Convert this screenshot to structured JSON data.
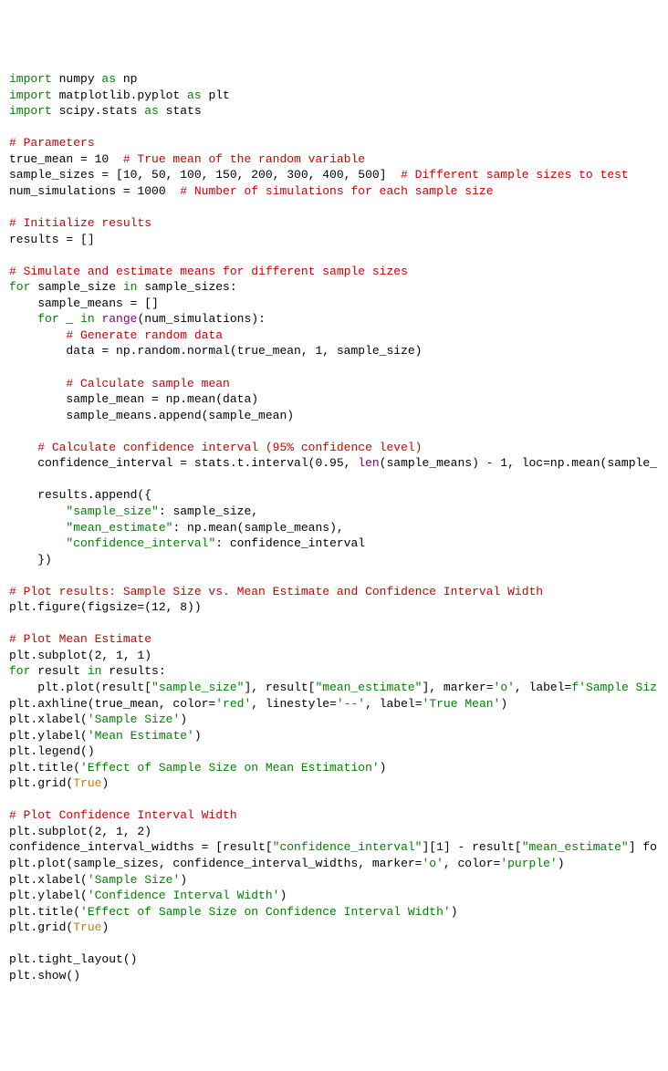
{
  "code": {
    "lines": [
      {
        "segments": [
          {
            "t": "import",
            "c": "kw"
          },
          {
            "t": " numpy "
          },
          {
            "t": "as",
            "c": "kw"
          },
          {
            "t": " np"
          }
        ]
      },
      {
        "segments": [
          {
            "t": "import",
            "c": "kw"
          },
          {
            "t": " matplotlib.pyplot "
          },
          {
            "t": "as",
            "c": "kw"
          },
          {
            "t": " plt"
          }
        ]
      },
      {
        "segments": [
          {
            "t": "import",
            "c": "kw"
          },
          {
            "t": " scipy.stats "
          },
          {
            "t": "as",
            "c": "kw"
          },
          {
            "t": " stats"
          }
        ]
      },
      {
        "segments": [
          {
            "t": ""
          }
        ]
      },
      {
        "segments": [
          {
            "t": "# Parameters",
            "c": "cm"
          }
        ]
      },
      {
        "segments": [
          {
            "t": "true_mean = 10  "
          },
          {
            "t": "# True mean of the random variable",
            "c": "cm"
          }
        ]
      },
      {
        "segments": [
          {
            "t": "sample_sizes = [10, 50, 100, 150, 200, 300, 400, 500]  "
          },
          {
            "t": "# Different sample sizes to test",
            "c": "cm"
          }
        ]
      },
      {
        "segments": [
          {
            "t": "num_simulations = 1000  "
          },
          {
            "t": "# Number of simulations for each sample size",
            "c": "cm"
          }
        ]
      },
      {
        "segments": [
          {
            "t": ""
          }
        ]
      },
      {
        "segments": [
          {
            "t": "# Initialize results",
            "c": "cm"
          }
        ]
      },
      {
        "segments": [
          {
            "t": "results = []"
          }
        ]
      },
      {
        "segments": [
          {
            "t": ""
          }
        ]
      },
      {
        "segments": [
          {
            "t": "# Simulate and estimate means for different sample sizes",
            "c": "cm"
          }
        ]
      },
      {
        "segments": [
          {
            "t": "for",
            "c": "kw"
          },
          {
            "t": " sample_size "
          },
          {
            "t": "in",
            "c": "kw"
          },
          {
            "t": " sample_sizes:"
          }
        ]
      },
      {
        "segments": [
          {
            "t": "    sample_means = []"
          }
        ]
      },
      {
        "segments": [
          {
            "t": "    "
          },
          {
            "t": "for",
            "c": "kw"
          },
          {
            "t": " _ "
          },
          {
            "t": "in",
            "c": "kw"
          },
          {
            "t": " "
          },
          {
            "t": "range",
            "c": "bi"
          },
          {
            "t": "(num_simulations):"
          }
        ]
      },
      {
        "segments": [
          {
            "t": "        "
          },
          {
            "t": "# Generate random data",
            "c": "cm"
          }
        ]
      },
      {
        "segments": [
          {
            "t": "        data = np.random.normal(true_mean, 1, sample_size)"
          }
        ]
      },
      {
        "segments": [
          {
            "t": ""
          }
        ]
      },
      {
        "segments": [
          {
            "t": "        "
          },
          {
            "t": "# Calculate sample mean",
            "c": "cm"
          }
        ]
      },
      {
        "segments": [
          {
            "t": "        sample_mean = np.mean(data)"
          }
        ]
      },
      {
        "segments": [
          {
            "t": "        sample_means.append(sample_mean)"
          }
        ]
      },
      {
        "segments": [
          {
            "t": ""
          }
        ]
      },
      {
        "segments": [
          {
            "t": "    "
          },
          {
            "t": "# Calculate confidence interval (95% confidence level)",
            "c": "cm"
          }
        ]
      },
      {
        "segments": [
          {
            "t": "    confidence_interval = stats.t.interval(0.95, "
          },
          {
            "t": "len",
            "c": "bi"
          },
          {
            "t": "(sample_means) - 1, loc=np.mean(sample_"
          }
        ]
      },
      {
        "segments": [
          {
            "t": ""
          }
        ]
      },
      {
        "segments": [
          {
            "t": "    results.append({"
          }
        ]
      },
      {
        "segments": [
          {
            "t": "        "
          },
          {
            "t": "\"sample_size\"",
            "c": "str"
          },
          {
            "t": ": sample_size,"
          }
        ]
      },
      {
        "segments": [
          {
            "t": "        "
          },
          {
            "t": "\"mean_estimate\"",
            "c": "str"
          },
          {
            "t": ": np.mean(sample_means),"
          }
        ]
      },
      {
        "segments": [
          {
            "t": "        "
          },
          {
            "t": "\"confidence_interval\"",
            "c": "str"
          },
          {
            "t": ": confidence_interval"
          }
        ]
      },
      {
        "segments": [
          {
            "t": "    })"
          }
        ]
      },
      {
        "segments": [
          {
            "t": ""
          }
        ]
      },
      {
        "segments": [
          {
            "t": "# Plot results: Sample Size vs. Mean Estimate and Confidence Interval Width",
            "c": "cm"
          }
        ]
      },
      {
        "segments": [
          {
            "t": "plt.figure(figsize=(12, 8))"
          }
        ]
      },
      {
        "segments": [
          {
            "t": ""
          }
        ]
      },
      {
        "segments": [
          {
            "t": "# Plot Mean Estimate",
            "c": "cm"
          }
        ]
      },
      {
        "segments": [
          {
            "t": "plt.subplot(2, 1, 1)"
          }
        ]
      },
      {
        "segments": [
          {
            "t": "for",
            "c": "kw"
          },
          {
            "t": " result "
          },
          {
            "t": "in",
            "c": "kw"
          },
          {
            "t": " results:"
          }
        ]
      },
      {
        "segments": [
          {
            "t": "    plt.plot(result["
          },
          {
            "t": "\"sample_size\"",
            "c": "str"
          },
          {
            "t": "], result["
          },
          {
            "t": "\"mean_estimate\"",
            "c": "str"
          },
          {
            "t": "], marker="
          },
          {
            "t": "'o'",
            "c": "str"
          },
          {
            "t": ", label="
          },
          {
            "t": "f'Sample Siz",
            "c": "str"
          }
        ]
      },
      {
        "segments": [
          {
            "t": "plt.axhline(true_mean, color="
          },
          {
            "t": "'red'",
            "c": "str"
          },
          {
            "t": ", linestyle="
          },
          {
            "t": "'--'",
            "c": "str"
          },
          {
            "t": ", label="
          },
          {
            "t": "'True Mean'",
            "c": "str"
          },
          {
            "t": ")"
          }
        ]
      },
      {
        "segments": [
          {
            "t": "plt.xlabel("
          },
          {
            "t": "'Sample Size'",
            "c": "str"
          },
          {
            "t": ")"
          }
        ]
      },
      {
        "segments": [
          {
            "t": "plt.ylabel("
          },
          {
            "t": "'Mean Estimate'",
            "c": "str"
          },
          {
            "t": ")"
          }
        ]
      },
      {
        "segments": [
          {
            "t": "plt.legend()"
          }
        ]
      },
      {
        "segments": [
          {
            "t": "plt.title("
          },
          {
            "t": "'Effect of Sample Size on Mean Estimation'",
            "c": "str"
          },
          {
            "t": ")"
          }
        ]
      },
      {
        "segments": [
          {
            "t": "plt.grid("
          },
          {
            "t": "True",
            "c": "bool"
          },
          {
            "t": ")"
          }
        ]
      },
      {
        "segments": [
          {
            "t": ""
          }
        ]
      },
      {
        "segments": [
          {
            "t": "# Plot Confidence Interval Width",
            "c": "cm"
          }
        ]
      },
      {
        "segments": [
          {
            "t": "plt.subplot(2, 1, 2)"
          }
        ]
      },
      {
        "segments": [
          {
            "t": "confidence_interval_widths = [result["
          },
          {
            "t": "\"confidence_interval\"",
            "c": "str"
          },
          {
            "t": "][1] - result["
          },
          {
            "t": "\"mean_estimate\"",
            "c": "str"
          },
          {
            "t": "] fo"
          }
        ]
      },
      {
        "segments": [
          {
            "t": "plt.plot(sample_sizes, confidence_interval_widths, marker="
          },
          {
            "t": "'o'",
            "c": "str"
          },
          {
            "t": ", color="
          },
          {
            "t": "'purple'",
            "c": "str"
          },
          {
            "t": ")"
          }
        ]
      },
      {
        "segments": [
          {
            "t": "plt.xlabel("
          },
          {
            "t": "'Sample Size'",
            "c": "str"
          },
          {
            "t": ")"
          }
        ]
      },
      {
        "segments": [
          {
            "t": "plt.ylabel("
          },
          {
            "t": "'Confidence Interval Width'",
            "c": "str"
          },
          {
            "t": ")"
          }
        ]
      },
      {
        "segments": [
          {
            "t": "plt.title("
          },
          {
            "t": "'Effect of Sample Size on Confidence Interval Width'",
            "c": "str"
          },
          {
            "t": ")"
          }
        ]
      },
      {
        "segments": [
          {
            "t": "plt.grid("
          },
          {
            "t": "True",
            "c": "bool"
          },
          {
            "t": ")"
          }
        ]
      },
      {
        "segments": [
          {
            "t": ""
          }
        ]
      },
      {
        "segments": [
          {
            "t": "plt.tight_layout()"
          }
        ]
      },
      {
        "segments": [
          {
            "t": "plt.show()"
          }
        ]
      }
    ]
  }
}
